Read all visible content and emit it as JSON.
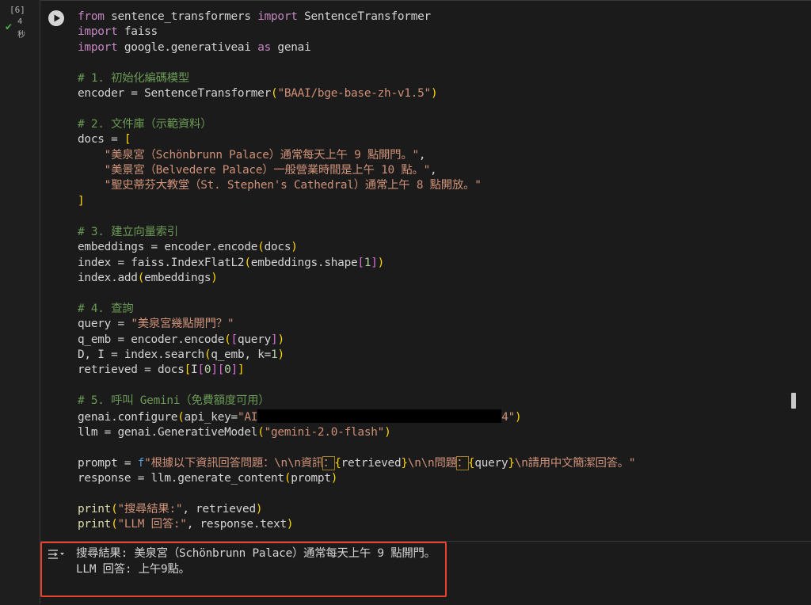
{
  "cell": {
    "execution_count": "[6]",
    "execution_time_value": "4",
    "execution_time_unit": "秒",
    "code_lines": [
      "from sentence_transformers import SentenceTransformer",
      "import faiss",
      "import google.generativeai as genai",
      "",
      "# 1. 初始化編碼模型",
      "encoder = SentenceTransformer(\"BAAI/bge-base-zh-v1.5\")",
      "",
      "# 2. 文件庫（示範資料）",
      "docs = [",
      "    \"美泉宮（Schönbrunn Palace）通常每天上午 9 點開門。\",",
      "    \"美景宮（Belvedere Palace）一般營業時間是上午 10 點。\",",
      "    \"聖史蒂芬大教堂（St. Stephen's Cathedral）通常上午 8 點開放。\"",
      "]",
      "",
      "# 3. 建立向量索引",
      "embeddings = encoder.encode(docs)",
      "index = faiss.IndexFlatL2(embeddings.shape[1])",
      "index.add(embeddings)",
      "",
      "# 4. 查詢",
      "query = \"美泉宮幾點開門？\"",
      "q_emb = encoder.encode([query])",
      "D, I = index.search(q_emb, k=1)",
      "retrieved = docs[I[0][0]]",
      "",
      "# 5. 呼叫 Gemini（免費額度可用）",
      "genai.configure(api_key=\"AI[REDACTED]4\")",
      "llm = genai.GenerativeModel(\"gemini-2.0-flash\")",
      "",
      "prompt = f\"根據以下資訊回答問題：\\n\\n資訊：{retrieved}\\n\\n問題：{query}\\n請用中文簡潔回答。\"",
      "response = llm.generate_content(prompt)",
      "",
      "print(\"搜尋結果:\", retrieved)",
      "print(\"LLM 回答:\", response.text)"
    ],
    "output_lines": [
      "搜尋結果: 美泉宮（Schönbrunn Palace）通常每天上午 9 點開門。",
      "LLM 回答: 上午9點。"
    ]
  },
  "icons": {
    "run": "play-circle-icon",
    "check": "check-icon",
    "output_toggle": "output-toggle-icon"
  },
  "colors": {
    "keyword": "#c586c0",
    "comment": "#6a9955",
    "string": "#ce9178",
    "highlight_box": "#e8412c",
    "success": "#4caf50"
  }
}
